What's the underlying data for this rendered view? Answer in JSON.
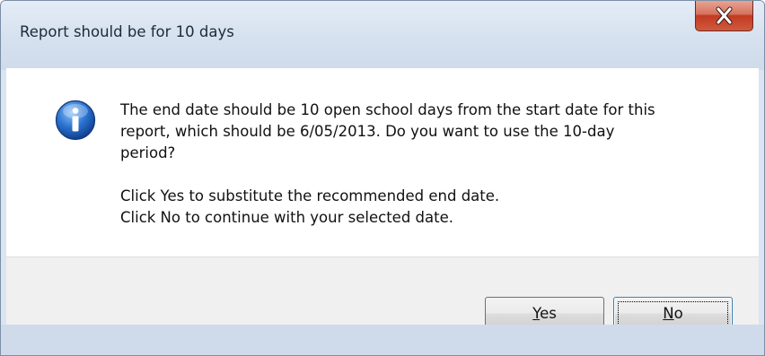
{
  "window": {
    "title": "Report should be for 10 days"
  },
  "message": {
    "line1": "The end date should be 10 open school days from the start date for this",
    "line2": "report, which should be 6/05/2013. Do you want to use the 10-day",
    "line3": "period?",
    "line4": "Click Yes to substitute the recommended end date.",
    "line5": "Click No to continue with your selected date."
  },
  "buttons": {
    "yes": {
      "accel": "Y",
      "rest": "es"
    },
    "no": {
      "accel": "N",
      "rest": "o"
    }
  },
  "icons": {
    "info": "information-icon",
    "close": "close-icon"
  },
  "colors": {
    "close_button": "#c23a21",
    "info_icon": "#1e5fbf",
    "focus_border": "#3c7fb1"
  }
}
